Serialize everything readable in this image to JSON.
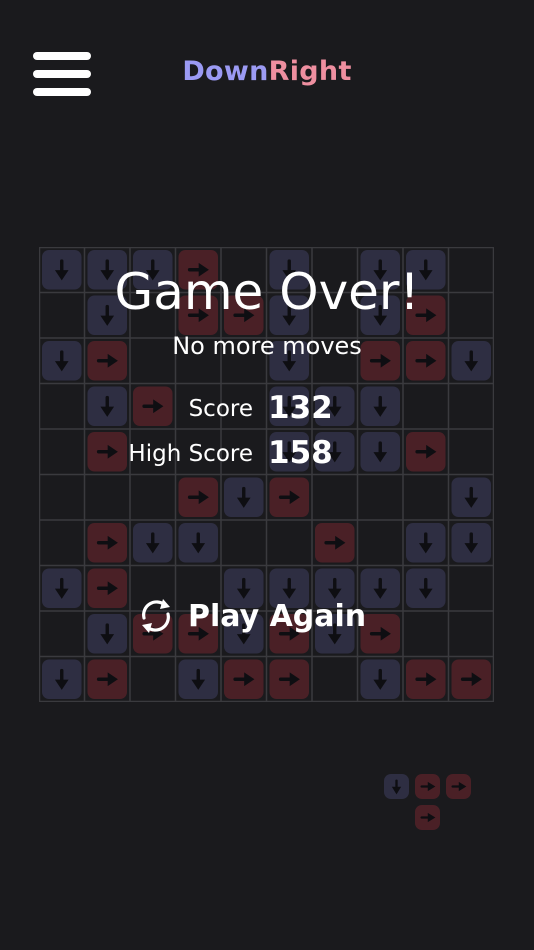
{
  "header": {
    "title_part1": "Down",
    "title_part2": "Right",
    "title_color1": "#9b9af3",
    "title_color2": "#ee8fa0"
  },
  "game_over": {
    "title": "Game Over!",
    "subtitle": "No more moves",
    "score_label": "Score",
    "score_value": "132",
    "high_score_label": "High Score",
    "high_score_value": "158",
    "play_again_label": "Play Again"
  },
  "colors": {
    "background": "#1a1a1d",
    "down_tile": "#2e2e42",
    "right_tile": "#4a2026",
    "arrow": "#0e0e12",
    "grid_line": "#3a3a3e"
  },
  "board": {
    "rows": 10,
    "cols": 10,
    "legend": "D = down arrow tile, R = right arrow tile, . = empty cell",
    "cells": [
      "DDDR.D.DD.",
      ".D.RRD.DR.",
      "DR...D.RRD",
      ".DR..DDD..",
      ".R...DDDR.",
      "...RDR...D",
      ".RDD..R.DDR",
      "DR..DDDDD.",
      ".DRRDRDR..",
      "DR.DRR.DRR"
    ]
  },
  "next_piece": {
    "cells": [
      "DRR",
      ".R."
    ]
  }
}
